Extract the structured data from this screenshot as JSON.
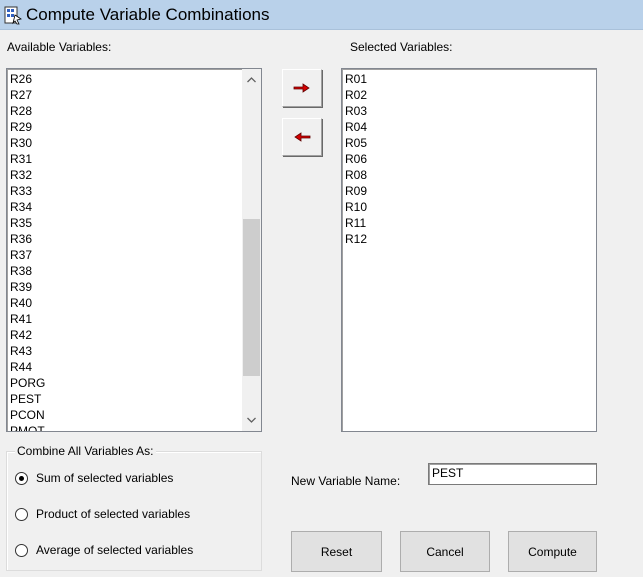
{
  "window": {
    "title": "Compute Variable Combinations"
  },
  "available": {
    "label": "Available Variables:",
    "items": [
      "R26",
      "R27",
      "R28",
      "R29",
      "R30",
      "R31",
      "R32",
      "R33",
      "R34",
      "R35",
      "R36",
      "R37",
      "R38",
      "R39",
      "R40",
      "R41",
      "R42",
      "R43",
      "R44",
      "PORG",
      "PEST",
      "PCON",
      "PMOT"
    ]
  },
  "selected": {
    "label": "Selected Variables:",
    "items": [
      "R01",
      "R02",
      "R03",
      "R04",
      "R05",
      "R06",
      "R08",
      "R09",
      "R10",
      "R11",
      "R12"
    ]
  },
  "combine": {
    "legend": "Combine All Variables As:",
    "options": [
      {
        "label": "Sum of selected variables",
        "checked": true
      },
      {
        "label": "Product of selected variables",
        "checked": false
      },
      {
        "label": "Average of selected variables",
        "checked": false
      }
    ]
  },
  "new_variable": {
    "label": "New Variable Name:",
    "value": "PEST"
  },
  "buttons": {
    "reset": "Reset",
    "cancel": "Cancel",
    "compute": "Compute"
  },
  "icons": {
    "add": "arrow-right-icon",
    "remove": "arrow-left-icon"
  },
  "colors": {
    "titlebar": "#b9d1ea",
    "arrow": "#d40000"
  }
}
